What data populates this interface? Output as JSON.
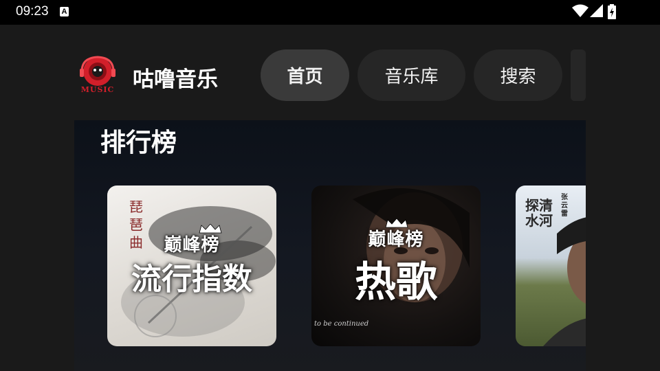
{
  "status_bar": {
    "time": "09:23",
    "notification_badge": "A",
    "icons": [
      "wifi-icon",
      "signal-icon",
      "battery-charging-icon"
    ]
  },
  "header": {
    "app_name": "咕噜音乐",
    "logo_text": "MUSIC",
    "tabs": [
      {
        "label": "首页",
        "active": true
      },
      {
        "label": "音乐库",
        "active": false
      },
      {
        "label": "搜索",
        "active": false
      }
    ]
  },
  "main": {
    "section_title": "排行榜",
    "cards": [
      {
        "brand": "巅峰榜",
        "title": "流行指数",
        "cover_text": "琵琶曲"
      },
      {
        "brand": "巅峰榜",
        "title": "热歌",
        "cover_text": "to be continued"
      },
      {
        "brand": "",
        "title": "",
        "cover_text": "探清水河",
        "cover_subtext": "张云雷"
      }
    ]
  },
  "colors": {
    "background": "#1a1a1a",
    "status_bar": "#000000",
    "tab_background": "#262626",
    "tab_active": "#3a3a3a",
    "logo_accent": "#d21f2a"
  }
}
